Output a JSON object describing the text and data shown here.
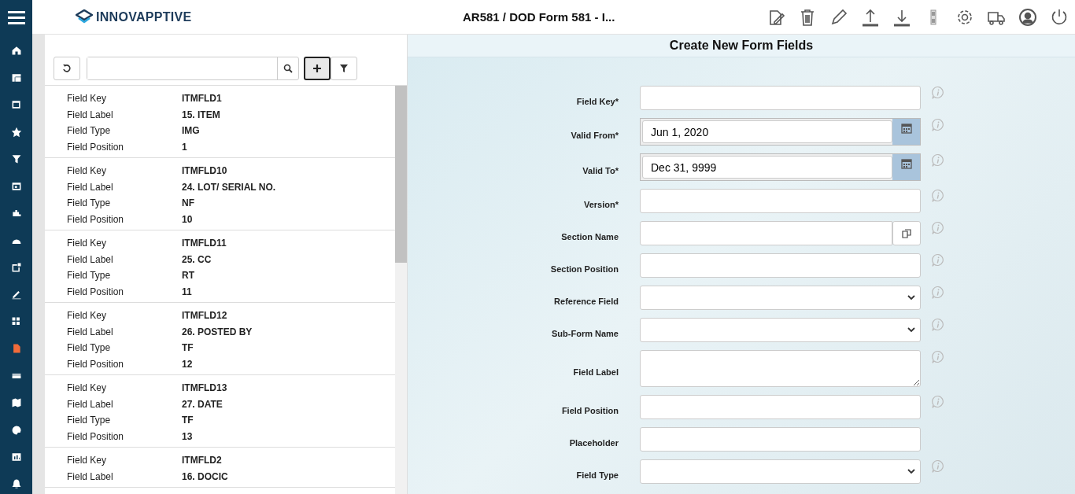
{
  "header": {
    "logo": "INNOVAPPTIVE",
    "title": "AR581 / DOD Form 581 - I..."
  },
  "list_panel": {
    "records": [
      {
        "fields": [
          {
            "label": "Field Key",
            "value": "ITMFLD1"
          },
          {
            "label": "Field Label",
            "value": "15. ITEM"
          },
          {
            "label": "Field Type",
            "value": "IMG"
          },
          {
            "label": "Field Position",
            "value": "1"
          }
        ]
      },
      {
        "fields": [
          {
            "label": "Field Key",
            "value": "ITMFLD10"
          },
          {
            "label": "Field Label",
            "value": "24. LOT/ SERIAL NO."
          },
          {
            "label": "Field Type",
            "value": "NF"
          },
          {
            "label": "Field Position",
            "value": "10"
          }
        ]
      },
      {
        "fields": [
          {
            "label": "Field Key",
            "value": "ITMFLD11"
          },
          {
            "label": "Field Label",
            "value": "25. CC"
          },
          {
            "label": "Field Type",
            "value": "RT"
          },
          {
            "label": "Field Position",
            "value": "11"
          }
        ]
      },
      {
        "fields": [
          {
            "label": "Field Key",
            "value": "ITMFLD12"
          },
          {
            "label": "Field Label",
            "value": "26. POSTED BY"
          },
          {
            "label": "Field Type",
            "value": "TF"
          },
          {
            "label": "Field Position",
            "value": "12"
          }
        ]
      },
      {
        "fields": [
          {
            "label": "Field Key",
            "value": "ITMFLD13"
          },
          {
            "label": "Field Label",
            "value": "27. DATE"
          },
          {
            "label": "Field Type",
            "value": "TF"
          },
          {
            "label": "Field Position",
            "value": "13"
          }
        ]
      },
      {
        "fields": [
          {
            "label": "Field Key",
            "value": "ITMFLD2"
          },
          {
            "label": "Field Label",
            "value": "16. DOCIC"
          }
        ]
      }
    ]
  },
  "form": {
    "title": "Create New Form Fields",
    "fields": [
      {
        "label": "Field Key*",
        "kind": "text",
        "info": true
      },
      {
        "label": "Valid From*",
        "kind": "date",
        "value": "Jun 1, 2020",
        "info": true
      },
      {
        "label": "Valid To*",
        "kind": "date",
        "value": "Dec 31, 9999",
        "info": true
      },
      {
        "label": "Version*",
        "kind": "text",
        "info": true
      },
      {
        "label": "Section Name",
        "kind": "lookup",
        "info": true
      },
      {
        "label": "Section Position",
        "kind": "text",
        "info": true
      },
      {
        "label": "Reference Field",
        "kind": "select",
        "info": true
      },
      {
        "label": "Sub-Form Name",
        "kind": "select",
        "info": true
      },
      {
        "label": "Field Label",
        "kind": "textarea",
        "info": true
      },
      {
        "label": "Field Position",
        "kind": "text",
        "info": true
      },
      {
        "label": "Placeholder",
        "kind": "text",
        "info": false
      },
      {
        "label": "Field Type",
        "kind": "select",
        "info": true
      }
    ]
  }
}
